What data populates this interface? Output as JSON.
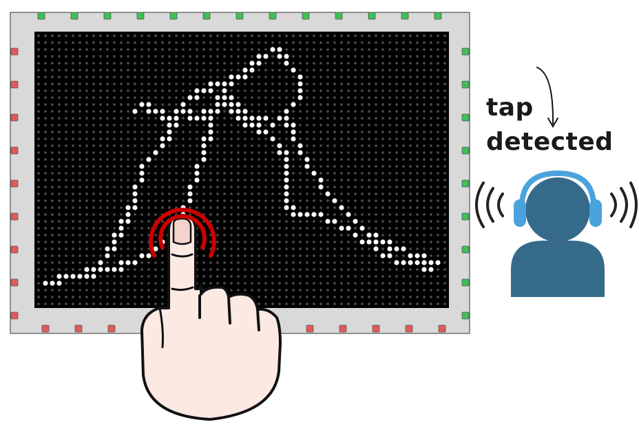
{
  "annotation": {
    "line1": "tap",
    "line2": "detected"
  },
  "display": {
    "grid_columns": 60,
    "grid_rows": 40
  },
  "sensors": {
    "colors": {
      "green": "#3fbf5a",
      "red": "#e05a5a"
    }
  },
  "colors": {
    "frame": "#d9d9d9",
    "screen": "#000000",
    "dot_off": "#4a4a4a",
    "dot_on": "#ffffff",
    "ripple": "#cc0000",
    "listener": "#356a8a",
    "headphones": "#4aa3dc"
  },
  "icons": {
    "hand": "pointing-hand-icon",
    "ripple": "tap-ripple-icon",
    "listener": "listener-with-headphones-icon",
    "sound_waves": "sound-waves-icon",
    "arrow": "curved-arrow-icon"
  }
}
